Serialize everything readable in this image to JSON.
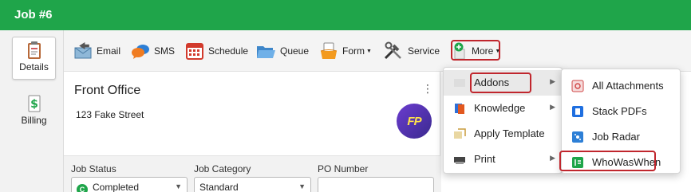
{
  "window": {
    "title": "Job #6"
  },
  "sidebar": {
    "items": [
      {
        "label": "Details",
        "icon": "clipboard-icon",
        "active": true
      },
      {
        "label": "Billing",
        "icon": "dollar-document-icon",
        "active": false
      }
    ]
  },
  "toolbar": {
    "buttons": [
      {
        "label": "Email",
        "icon": "email-icon"
      },
      {
        "label": "SMS",
        "icon": "chat-bubbles-icon"
      },
      {
        "label": "Schedule",
        "icon": "calendar-icon"
      },
      {
        "label": "Queue",
        "icon": "folder-icon"
      },
      {
        "label": "Form",
        "icon": "form-icon",
        "dropdown": true
      },
      {
        "label": "Service",
        "icon": "tools-icon"
      },
      {
        "label": "More",
        "icon": "plus-circle-icon",
        "dropdown": true
      }
    ]
  },
  "job": {
    "client_name": "Front Office",
    "address": "123 Fake Street",
    "logo_text": "FP"
  },
  "fields": {
    "job_status": {
      "label": "Job Status",
      "value": "Completed",
      "status_letter": "C"
    },
    "job_category": {
      "label": "Job Category",
      "value": "Standard"
    },
    "po_number": {
      "label": "PO Number",
      "value": ""
    }
  },
  "more_menu": {
    "items": [
      {
        "label": "Addons",
        "icon": "addons-icon",
        "has_submenu": true,
        "highlighted": true
      },
      {
        "label": "Knowledge",
        "icon": "book-icon",
        "has_submenu": true
      },
      {
        "label": "Apply Template",
        "icon": "template-icon",
        "has_submenu": false
      },
      {
        "label": "Print",
        "icon": "printer-icon",
        "has_submenu": true
      }
    ]
  },
  "addons_menu": {
    "items": [
      {
        "label": "All Attachments",
        "icon": "attachments-icon"
      },
      {
        "label": "Stack PDFs",
        "icon": "stack-pdf-icon"
      },
      {
        "label": "Job Radar",
        "icon": "radar-icon"
      },
      {
        "label": "WhoWasWhen",
        "icon": "whowaswhen-icon",
        "highlighted": true
      }
    ]
  },
  "colors": {
    "header_green": "#1fa54a",
    "highlight_red": "#c0262d",
    "status_green": "#1fa54a"
  }
}
